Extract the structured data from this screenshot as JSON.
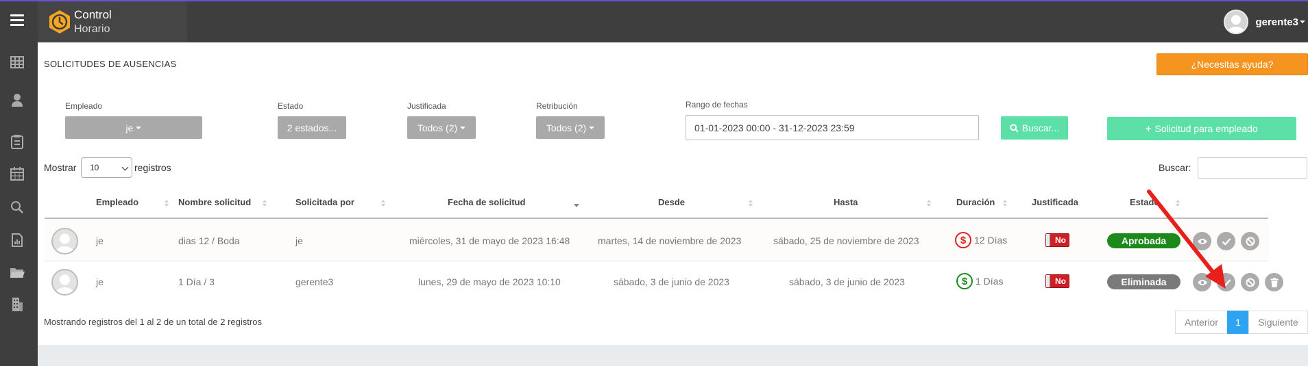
{
  "app": {
    "brand_line1": "Control",
    "brand_line2": "Horario",
    "user_name": "gerente3"
  },
  "page": {
    "title": "SOLICITUDES DE AUSENCIAS",
    "help_label": "¿Necesitas ayuda?"
  },
  "filters": {
    "empleado_label": "Empleado",
    "empleado_value": "je",
    "estado_label": "Estado",
    "estado_value": "2 estados...",
    "justificada_label": "Justificada",
    "justificada_value": "Todos (2)",
    "retribucion_label": "Retribución",
    "retribucion_value": "Todos (2)",
    "fechas_label": "Rango de fechas",
    "fechas_value": "01-01-2023 00:00 - 31-12-2023 23:59",
    "buscar_label": "Buscar...",
    "nueva_label": "Solicitud para empleado"
  },
  "table_controls": {
    "show_label": "Mostrar",
    "page_length": "10",
    "records_label": "registros",
    "search_label": "Buscar:"
  },
  "table": {
    "headers": [
      "Empleado",
      "Nombre solicitud",
      "Solicitada por",
      "Fecha de solicitud",
      "Desde",
      "Hasta",
      "Duración",
      "Justificada",
      "Estado"
    ],
    "rows": [
      {
        "employee": "je",
        "name": "dias 12 / Boda",
        "requested_by": "je",
        "requested_at": "miércoles, 31 de mayo de 2023 16:48",
        "from": "martes, 14 de noviembre de 2023",
        "to": "sábado, 25 de noviembre de 2023",
        "duration": "12 Días",
        "paid": "$",
        "justified": "No",
        "status": "Aprobada",
        "status_color": "#1b8a1b",
        "dollar_color": "#e02020"
      },
      {
        "employee": "je",
        "name": "1 Día / 3",
        "requested_by": "gerente3",
        "requested_at": "lunes, 29 de mayo de 2023 10:10",
        "from": "sábado, 3 de junio de 2023",
        "to": "sábado, 3 de junio de 2023",
        "duration": "1 Días",
        "paid": "$",
        "justified": "No",
        "status": "Eliminada",
        "status_color": "#7a7a7a",
        "dollar_color": "#1b8a1b"
      }
    ]
  },
  "footer": {
    "info": "Mostrando registros del 1 al 2 de un total de 2 registros",
    "prev": "Anterior",
    "page": "1",
    "next": "Siguiente"
  },
  "colors": {
    "accent_orange": "#f5951f",
    "green_button": "#5ce0a8",
    "pager_active": "#2ea3f2",
    "annotation_arrow": "#e8201c"
  }
}
